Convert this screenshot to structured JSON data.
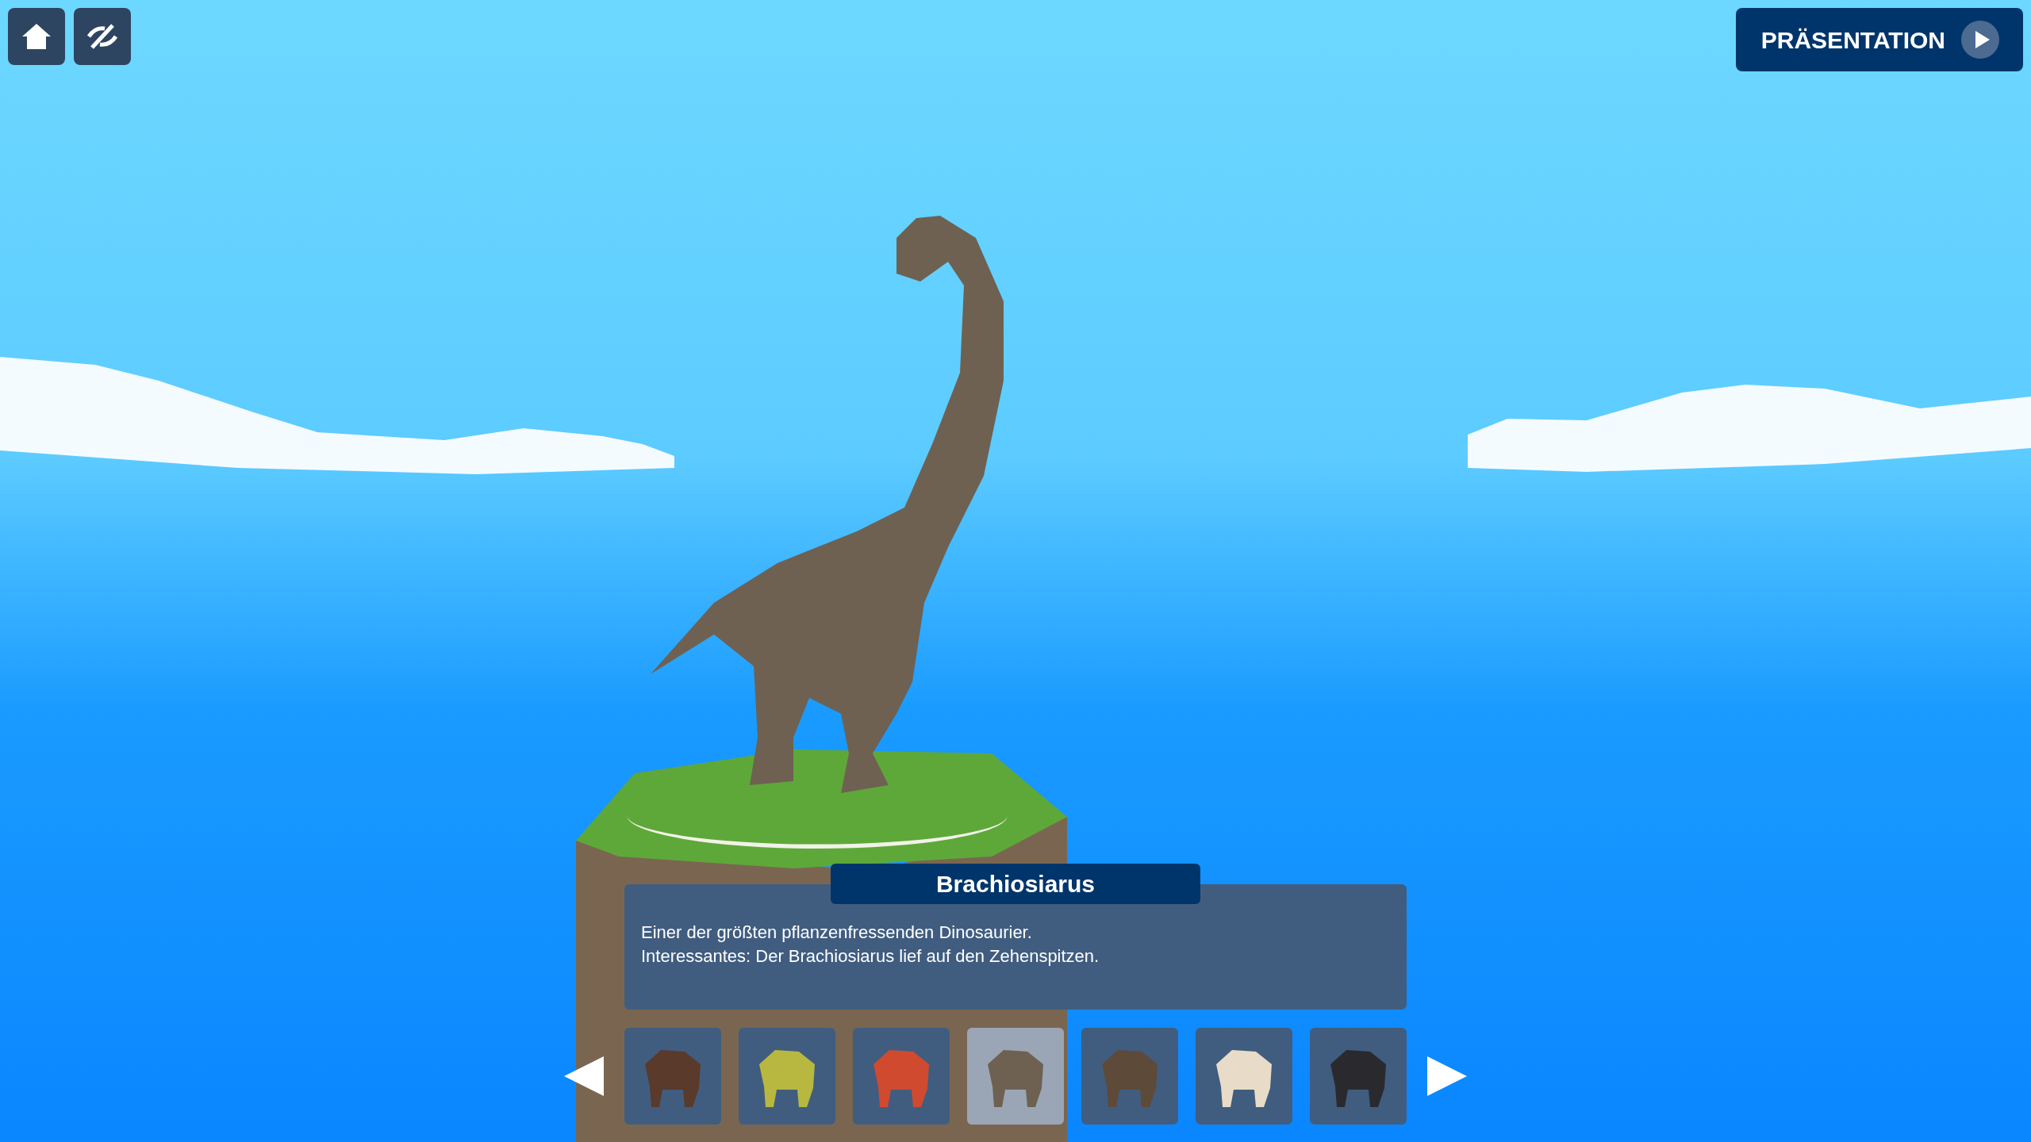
{
  "toolbar": {
    "buttons": [
      {
        "kind": "home"
      },
      {
        "kind": "hide"
      }
    ]
  },
  "presentation_button": {
    "label": "PRÄSENTATION"
  },
  "info_panel": {
    "title": "Brachiosiarus",
    "lines": [
      "Einer der größten pflanzenfressenden Dinosaurier.",
      "Interessantes: Der Brachiosiarus lief auf den Zehenspitzen."
    ]
  },
  "carousel": {
    "items": [
      {
        "selected": false,
        "color": "#5a3a2a"
      },
      {
        "selected": false,
        "color": "#b8b840"
      },
      {
        "selected": false,
        "color": "#d04a30"
      },
      {
        "selected": true,
        "color": "#6e6152"
      },
      {
        "selected": false,
        "color": "#5e4a38"
      },
      {
        "selected": false,
        "color": "#e8dcc8"
      },
      {
        "selected": false,
        "color": "#2a2a2e"
      }
    ]
  }
}
